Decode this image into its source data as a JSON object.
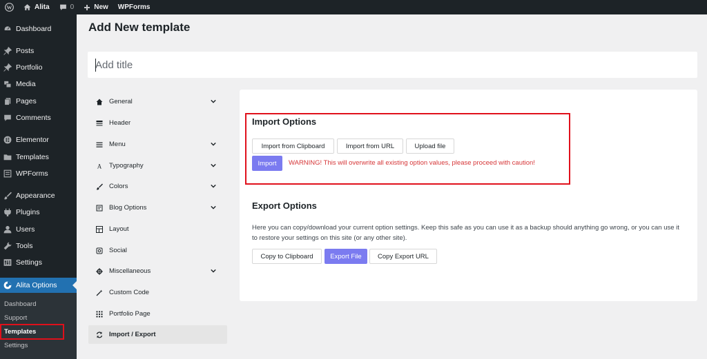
{
  "adminbar": {
    "site_name": "Alita",
    "comments_count": "0",
    "new_label": "New",
    "wpforms_label": "WPForms"
  },
  "sidebar": {
    "items": [
      {
        "label": "Dashboard",
        "icon": "dashboard-icon"
      },
      {
        "label": "Posts",
        "icon": "pin-icon"
      },
      {
        "label": "Portfolio",
        "icon": "pin-icon"
      },
      {
        "label": "Media",
        "icon": "media-icon"
      },
      {
        "label": "Pages",
        "icon": "pages-icon"
      },
      {
        "label": "Comments",
        "icon": "comment-icon"
      },
      {
        "label": "Elementor",
        "icon": "elementor-icon"
      },
      {
        "label": "Templates",
        "icon": "folder-icon"
      },
      {
        "label": "WPForms",
        "icon": "wpforms-icon"
      },
      {
        "label": "Appearance",
        "icon": "brush-icon"
      },
      {
        "label": "Plugins",
        "icon": "plug-icon"
      },
      {
        "label": "Users",
        "icon": "user-icon"
      },
      {
        "label": "Tools",
        "icon": "wrench-icon"
      },
      {
        "label": "Settings",
        "icon": "settings-icon"
      },
      {
        "label": "Alita Options",
        "icon": "palette-icon"
      }
    ],
    "submenu": [
      "Dashboard",
      "Support",
      "Templates",
      "Settings"
    ]
  },
  "main": {
    "page_title": "Add New template",
    "title_placeholder": "Add title"
  },
  "options_nav": [
    {
      "label": "General",
      "icon": "home-icon",
      "has_chevron": true
    },
    {
      "label": "Header",
      "icon": "header-icon",
      "has_chevron": false
    },
    {
      "label": "Menu",
      "icon": "menu-icon",
      "has_chevron": true
    },
    {
      "label": "Typography",
      "icon": "typography-icon",
      "has_chevron": true
    },
    {
      "label": "Colors",
      "icon": "brush-icon",
      "has_chevron": true
    },
    {
      "label": "Blog Options",
      "icon": "blog-icon",
      "has_chevron": true
    },
    {
      "label": "Layout",
      "icon": "layout-icon",
      "has_chevron": false
    },
    {
      "label": "Social",
      "icon": "social-icon",
      "has_chevron": false
    },
    {
      "label": "Miscellaneous",
      "icon": "gear-icon",
      "has_chevron": true
    },
    {
      "label": "Custom Code",
      "icon": "magic-icon",
      "has_chevron": false
    },
    {
      "label": "Portfolio Page",
      "icon": "grid-icon",
      "has_chevron": false
    },
    {
      "label": "Import / Export",
      "icon": "refresh-icon",
      "has_chevron": false
    }
  ],
  "import": {
    "title": "Import Options",
    "from_clipboard": "Import from Clipboard",
    "from_url": "Import from URL",
    "upload_file": "Upload file",
    "import_button": "Import",
    "warning": "WARNING! This will overwrite all existing option values, please proceed with caution!"
  },
  "export": {
    "title": "Export Options",
    "description": "Here you can copy/download your current option settings. Keep this safe as you can use it as a backup should anything go wrong, or you can use it to restore your settings on this site (or any other site).",
    "copy_clipboard": "Copy to Clipboard",
    "export_file": "Export File",
    "copy_url": "Copy Export URL"
  },
  "colors": {
    "sidebar_bg": "#1d2327",
    "active_blue": "#2271b1",
    "primary_button": "#7b7bf0",
    "warning_red": "#d63638",
    "highlight_red": "#e0101b"
  }
}
